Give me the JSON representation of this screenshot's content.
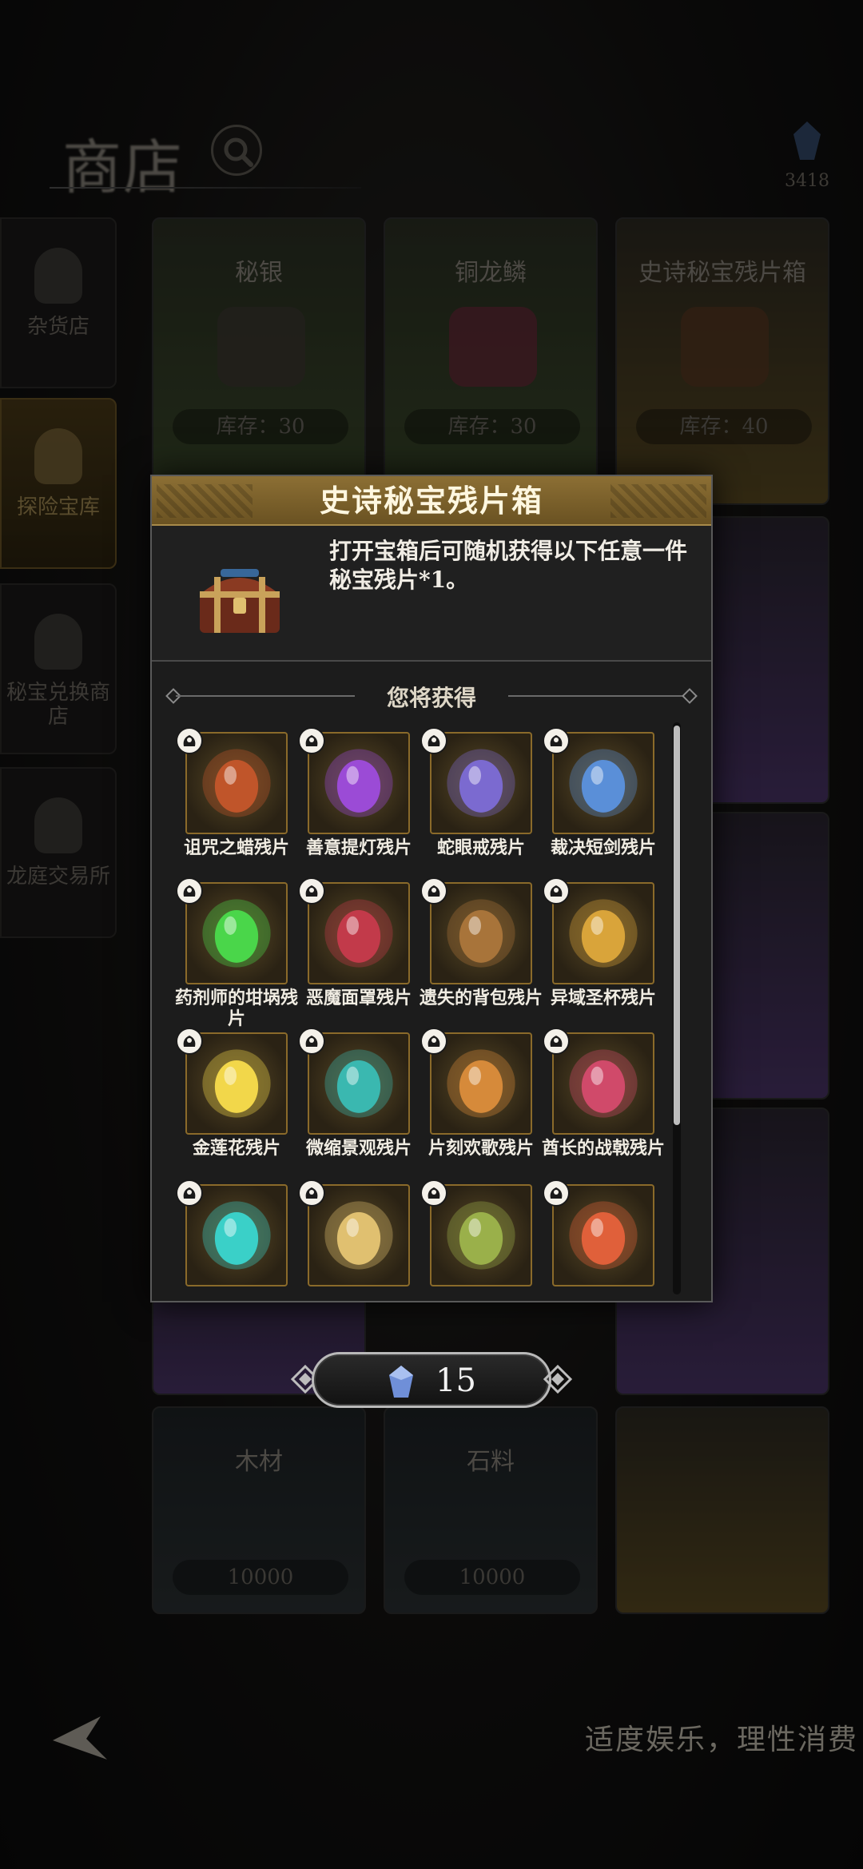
{
  "shop": {
    "title": "商店",
    "currency_value": "3418",
    "slogan": "适度娱乐，理性消费"
  },
  "sidebar": {
    "items": [
      {
        "label": "杂货店"
      },
      {
        "label": "探险宝库"
      },
      {
        "label": "秘宝兑换商店"
      },
      {
        "label": "龙庭交易所"
      }
    ]
  },
  "bg_cards": [
    {
      "name": "秘银",
      "stock": "库存：30",
      "tone": "green"
    },
    {
      "name": "铜龙鳞",
      "stock": "库存：30",
      "tone": "green"
    },
    {
      "name": "史诗秘宝残片箱",
      "stock": "库存：40",
      "tone": "gold"
    },
    {
      "name": "木材",
      "stock": "10000",
      "tone": "dark"
    },
    {
      "name": "石料",
      "stock": "10000",
      "tone": "dark"
    }
  ],
  "modal": {
    "title": "史诗秘宝残片箱",
    "description": "打开宝箱后可随机获得以下任意一件秘宝残片*1。",
    "rewards_title": "您将获得",
    "items": [
      {
        "name": "诅咒之蜡残片",
        "icon": "cursed-candle-icon",
        "color": "#c0552a"
      },
      {
        "name": "善意提灯残片",
        "icon": "lantern-icon",
        "color": "#9b4bd6"
      },
      {
        "name": "蛇眼戒残片",
        "icon": "snake-eye-ring-icon",
        "color": "#7b6ad0"
      },
      {
        "name": "裁决短剑残片",
        "icon": "dagger-icon",
        "color": "#5a8fd8"
      },
      {
        "name": "药剂师的坩埚残片",
        "icon": "cauldron-icon",
        "color": "#4ad64a"
      },
      {
        "name": "恶魔面罩残片",
        "icon": "demon-mask-icon",
        "color": "#c23a4a"
      },
      {
        "name": "遗失的背包残片",
        "icon": "backpack-icon",
        "color": "#a8743a"
      },
      {
        "name": "异域圣杯残片",
        "icon": "grail-icon",
        "color": "#d9a43a"
      },
      {
        "name": "金莲花残片",
        "icon": "lotus-icon",
        "color": "#f2d74a"
      },
      {
        "name": "微缩景观残片",
        "icon": "terrarium-icon",
        "color": "#3ab8b0"
      },
      {
        "name": "片刻欢歌残片",
        "icon": "song-icon",
        "color": "#d68a3a"
      },
      {
        "name": "酋长的战戟残片",
        "icon": "halberd-icon",
        "color": "#d04a6a"
      },
      {
        "name": "",
        "icon": "bracelet-icon",
        "color": "#3ad0c8"
      },
      {
        "name": "",
        "icon": "tapestry-icon",
        "color": "#e0c070"
      },
      {
        "name": "",
        "icon": "hunter-icon",
        "color": "#9ab04a"
      },
      {
        "name": "",
        "icon": "warrior-icon",
        "color": "#e0603a"
      }
    ]
  },
  "price": {
    "value": "15"
  },
  "colors": {
    "accent_gold": "#8c6f34",
    "modal_bg": "#1c1c1c"
  }
}
